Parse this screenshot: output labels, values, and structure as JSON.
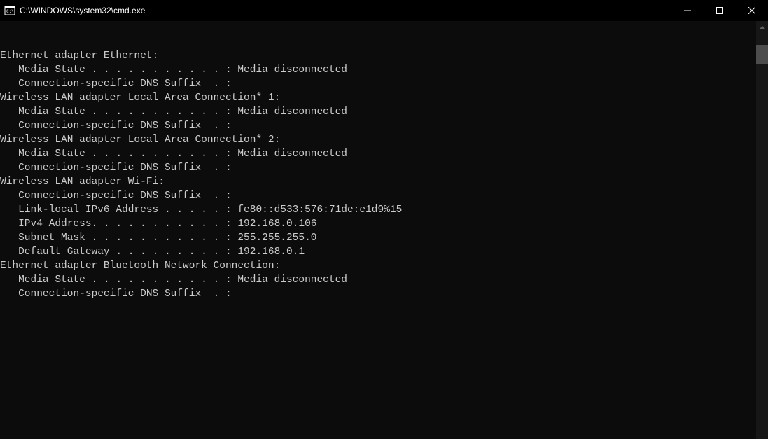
{
  "titlebar": {
    "title": "C:\\WINDOWS\\system32\\cmd.exe"
  },
  "lines": {
    "l0": "",
    "l1": "",
    "l2": "Ethernet adapter Ethernet:",
    "l3": "",
    "l4": "   Media State . . . . . . . . . . . : Media disconnected",
    "l5": "   Connection-specific DNS Suffix  . :",
    "l6": "",
    "l7": "Wireless LAN adapter Local Area Connection* 1:",
    "l8": "",
    "l9": "   Media State . . . . . . . . . . . : Media disconnected",
    "l10": "   Connection-specific DNS Suffix  . :",
    "l11": "",
    "l12": "Wireless LAN adapter Local Area Connection* 2:",
    "l13": "",
    "l14": "   Media State . . . . . . . . . . . : Media disconnected",
    "l15": "   Connection-specific DNS Suffix  . :",
    "l16": "",
    "l17": "Wireless LAN adapter Wi-Fi:",
    "l18": "",
    "l19": "   Connection-specific DNS Suffix  . :",
    "l20": "   Link-local IPv6 Address . . . . . : fe80::d533:576:71de:e1d9%15",
    "l21": "   IPv4 Address. . . . . . . . . . . : 192.168.0.106",
    "l22": "   Subnet Mask . . . . . . . . . . . : 255.255.255.0",
    "l23": "   Default Gateway . . . . . . . . . : 192.168.0.1",
    "l24": "",
    "l25": "Ethernet adapter Bluetooth Network Connection:",
    "l26": "",
    "l27": "   Media State . . . . . . . . . . . : Media disconnected",
    "l28": "   Connection-specific DNS Suffix  . :"
  }
}
